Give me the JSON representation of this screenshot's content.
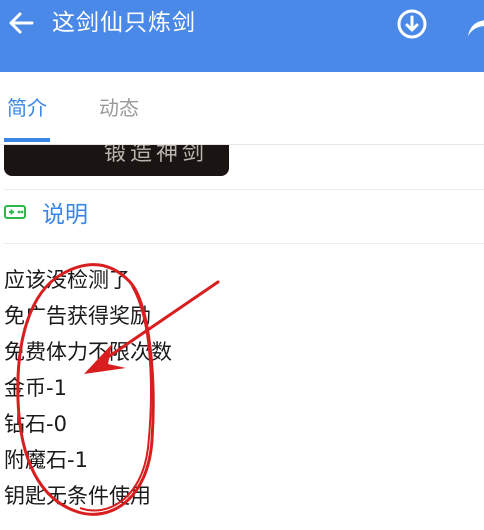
{
  "appbar": {
    "title": "这剑仙只炼剑",
    "back_icon": "arrow-left-icon",
    "download_icon": "download-circle-icon",
    "share_icon": "share-icon",
    "background_color": "#4a89e8"
  },
  "tabs": [
    {
      "label": "简介",
      "active": true
    },
    {
      "label": "动态",
      "active": false
    }
  ],
  "accent_color": "#3a86e6",
  "screenshot_caption": "锻造神剑",
  "section": {
    "icon": "gamepad-icon",
    "title": "说明",
    "lines": [
      "应该没检测了",
      "免广告获得奖励",
      "免费体力不限次数",
      "金币-1",
      "钻石-0",
      "附魔石-1",
      "钥匙无条件使用"
    ]
  },
  "annotation": {
    "color": "#d81e1e",
    "shapes": [
      "ellipse",
      "arrow"
    ]
  }
}
